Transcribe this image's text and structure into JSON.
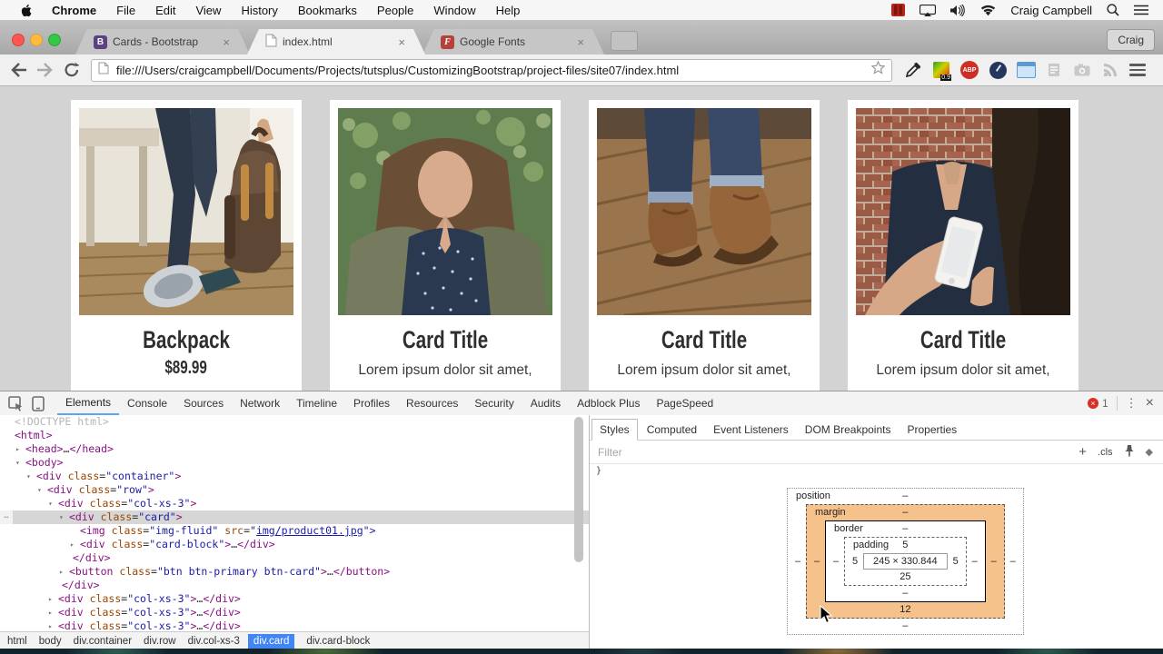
{
  "menubar": {
    "items": [
      "Chrome",
      "File",
      "Edit",
      "View",
      "History",
      "Bookmarks",
      "People",
      "Window",
      "Help"
    ],
    "right": {
      "username": "Craig Campbell"
    }
  },
  "tabstrip": {
    "tabs": [
      {
        "label": "Cards - Bootstrap",
        "favicon": "bootstrap",
        "favicon_glyph": "B"
      },
      {
        "label": "index.html",
        "favicon": "page",
        "favicon_glyph": ""
      },
      {
        "label": "Google Fonts",
        "favicon": "google-fonts",
        "favicon_glyph": "F"
      }
    ],
    "active_tab_index": 1,
    "profile_label": "Craig"
  },
  "toolbar": {
    "url": "file:///Users/craigcampbell/Documents/Projects/tutsplus/CustomizingBootstrap/project-files/site07/index.html",
    "ext_abp_label": "ABP",
    "ext_colorzilla_badge": "0.9"
  },
  "page": {
    "cards": [
      {
        "title": "Backpack",
        "subtitle": "$89.99",
        "image": "backpack-product-photo"
      },
      {
        "title": "Card Title",
        "subtitle": "Lorem ipsum dolor sit amet,",
        "image": "woman-portrait-photo"
      },
      {
        "title": "Card Title",
        "subtitle": "Lorem ipsum dolor sit amet,",
        "image": "brown-boots-photo"
      },
      {
        "title": "Card Title",
        "subtitle": "Lorem ipsum dolor sit amet,",
        "image": "woman-with-phone-photo"
      }
    ]
  },
  "devtools": {
    "tabs": [
      "Elements",
      "Console",
      "Sources",
      "Network",
      "Timeline",
      "Profiles",
      "Resources",
      "Security",
      "Audits",
      "Adblock Plus",
      "PageSpeed"
    ],
    "active_tab": "Elements",
    "error_count": "1",
    "dom_tree": {
      "lines": [
        {
          "pad": 16,
          "arrow": "",
          "sel": false,
          "toks": [
            [
              "gray",
              "<!DOCTYPE html>"
            ]
          ]
        },
        {
          "pad": 16,
          "arrow": "",
          "sel": false,
          "toks": [
            [
              "tag",
              "<html>"
            ]
          ]
        },
        {
          "pad": 28,
          "arrow": "r",
          "sel": false,
          "toks": [
            [
              "tag",
              "<head>"
            ],
            [
              "plain",
              "…"
            ],
            [
              "tag",
              "</head>"
            ]
          ]
        },
        {
          "pad": 28,
          "arrow": "d",
          "sel": false,
          "toks": [
            [
              "tag",
              "<body>"
            ]
          ]
        },
        {
          "pad": 40,
          "arrow": "d",
          "sel": false,
          "toks": [
            [
              "tag",
              "<div "
            ],
            [
              "attr",
              "class"
            ],
            [
              "plain",
              "="
            ],
            [
              "val",
              "\"container\""
            ],
            [
              "tag",
              ">"
            ]
          ]
        },
        {
          "pad": 52,
          "arrow": "d",
          "sel": false,
          "toks": [
            [
              "tag",
              "<div "
            ],
            [
              "attr",
              "class"
            ],
            [
              "plain",
              "="
            ],
            [
              "val",
              "\"row\""
            ],
            [
              "tag",
              ">"
            ]
          ]
        },
        {
          "pad": 64,
          "arrow": "d",
          "sel": false,
          "toks": [
            [
              "tag",
              "<div "
            ],
            [
              "attr",
              "class"
            ],
            [
              "plain",
              "="
            ],
            [
              "val",
              "\"col-xs-3\""
            ],
            [
              "tag",
              ">"
            ]
          ]
        },
        {
          "pad": 76,
          "arrow": "d",
          "sel": true,
          "toks": [
            [
              "tag",
              "<div "
            ],
            [
              "attr",
              "class"
            ],
            [
              "plain",
              "="
            ],
            [
              "val",
              "\"card\""
            ],
            [
              "tag",
              ">"
            ]
          ]
        },
        {
          "pad": 88,
          "arrow": "",
          "sel": false,
          "toks": [
            [
              "tag",
              "<img "
            ],
            [
              "attr",
              "class"
            ],
            [
              "plain",
              "="
            ],
            [
              "val",
              "\"img-fluid\""
            ],
            [
              "plain",
              " "
            ],
            [
              "attr",
              "src"
            ],
            [
              "plain",
              "="
            ],
            [
              "val",
              "\""
            ],
            [
              "link",
              "img/product01.jpg"
            ],
            [
              "val",
              "\">"
            ]
          ]
        },
        {
          "pad": 88,
          "arrow": "r",
          "sel": false,
          "toks": [
            [
              "tag",
              "<div "
            ],
            [
              "attr",
              "class"
            ],
            [
              "plain",
              "="
            ],
            [
              "val",
              "\"card-block\""
            ],
            [
              "tag",
              ">"
            ],
            [
              "plain",
              "…"
            ],
            [
              "tag",
              "</div>"
            ]
          ]
        },
        {
          "pad": 80,
          "arrow": "",
          "sel": false,
          "toks": [
            [
              "tag",
              "</div>"
            ]
          ]
        },
        {
          "pad": 76,
          "arrow": "r",
          "sel": false,
          "toks": [
            [
              "tag",
              "<button "
            ],
            [
              "attr",
              "class"
            ],
            [
              "plain",
              "="
            ],
            [
              "val",
              "\"btn btn-primary btn-card\""
            ],
            [
              "tag",
              ">"
            ],
            [
              "plain",
              "…"
            ],
            [
              "tag",
              "</button>"
            ]
          ]
        },
        {
          "pad": 68,
          "arrow": "",
          "sel": false,
          "toks": [
            [
              "tag",
              "</div>"
            ]
          ]
        },
        {
          "pad": 64,
          "arrow": "r",
          "sel": false,
          "toks": [
            [
              "tag",
              "<div "
            ],
            [
              "attr",
              "class"
            ],
            [
              "plain",
              "="
            ],
            [
              "val",
              "\"col-xs-3\""
            ],
            [
              "tag",
              ">"
            ],
            [
              "plain",
              "…"
            ],
            [
              "tag",
              "</div>"
            ]
          ]
        },
        {
          "pad": 64,
          "arrow": "r",
          "sel": false,
          "toks": [
            [
              "tag",
              "<div "
            ],
            [
              "attr",
              "class"
            ],
            [
              "plain",
              "="
            ],
            [
              "val",
              "\"col-xs-3\""
            ],
            [
              "tag",
              ">"
            ],
            [
              "plain",
              "…"
            ],
            [
              "tag",
              "</div>"
            ]
          ]
        },
        {
          "pad": 64,
          "arrow": "r",
          "sel": false,
          "toks": [
            [
              "tag",
              "<div "
            ],
            [
              "attr",
              "class"
            ],
            [
              "plain",
              "="
            ],
            [
              "val",
              "\"col-xs-3\""
            ],
            [
              "tag",
              ">"
            ],
            [
              "plain",
              "…"
            ],
            [
              "tag",
              "</div>"
            ]
          ]
        }
      ]
    },
    "styles_panel": {
      "tabs": [
        "Styles",
        "Computed",
        "Event Listeners",
        "DOM Breakpoints",
        "Properties"
      ],
      "active_tab": "Styles",
      "filter_placeholder": "Filter",
      "cls_label": ".cls",
      "plus_label": "+",
      "brace": "}",
      "box_model": {
        "position": {
          "label": "position",
          "top": "–",
          "right": "–",
          "bottom": "–",
          "left": "–"
        },
        "margin": {
          "label": "margin",
          "top": "–",
          "right": "–",
          "bottom": "12",
          "left": "–"
        },
        "border": {
          "label": "border",
          "top": "–",
          "right": "–",
          "bottom": "–",
          "left": "–"
        },
        "padding": {
          "label": "padding",
          "top": "5",
          "right": "5",
          "bottom": "25",
          "left": "5"
        },
        "content": "245 × 330.844"
      }
    },
    "breadcrumbs": [
      {
        "label": "html",
        "selected": false
      },
      {
        "label": "body",
        "selected": false
      },
      {
        "label": "div.container",
        "selected": false
      },
      {
        "label": "div.row",
        "selected": false
      },
      {
        "label": "div.col-xs-3",
        "selected": false
      },
      {
        "label": "div.card",
        "selected": true
      },
      {
        "label": "div.card-block",
        "selected": false
      }
    ]
  },
  "icons": {
    "close": "×",
    "kebab": "⋮",
    "ellipsis": "…",
    "arrow_down": "▾",
    "arrow_right": "▸",
    "diamond": "◆"
  }
}
